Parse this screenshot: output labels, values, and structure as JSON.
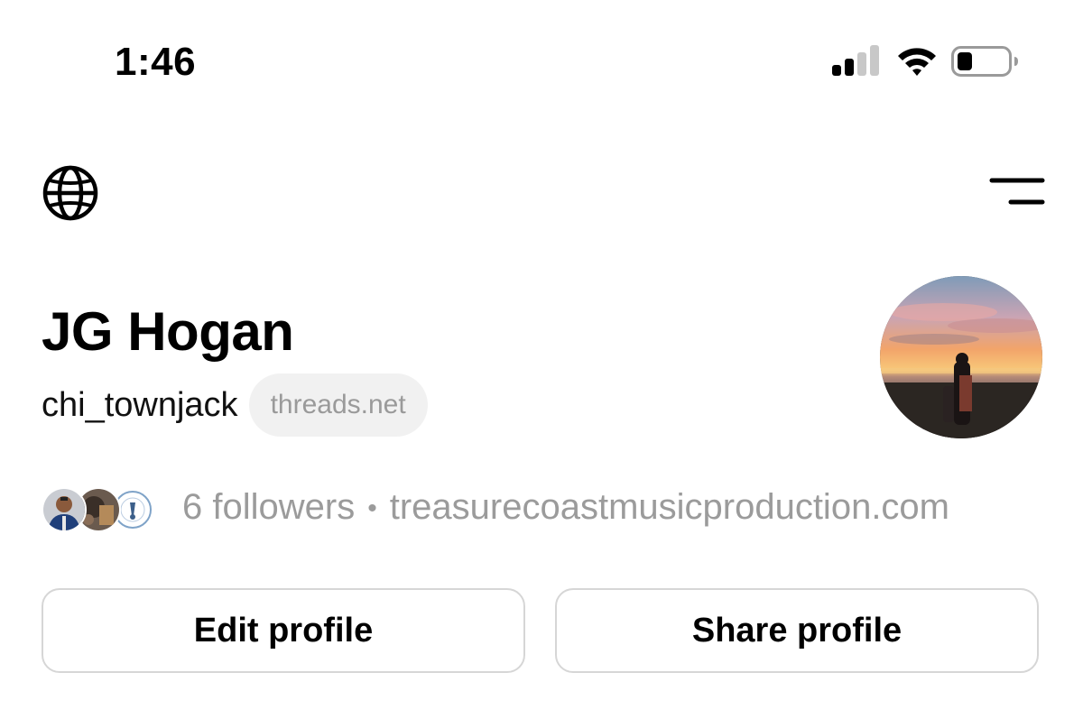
{
  "status_bar": {
    "time": "1:46",
    "icons": [
      "cellular-signal-icon",
      "wifi-icon",
      "battery-icon"
    ],
    "battery_level": 0.3
  },
  "nav": {
    "left_icon": "globe-icon",
    "right_icon": "menu-icon"
  },
  "profile": {
    "name": "JG Hogan",
    "handle": "chi_townjack",
    "domain_badge": "threads.net",
    "avatar": "sunset-beach-photo"
  },
  "followers": {
    "count_text": "6 followers",
    "separator": "•",
    "link": "treasurecoastmusicproduction.com",
    "avatars": [
      "follower-avatar-1",
      "follower-avatar-2",
      "follower-avatar-3"
    ]
  },
  "actions": {
    "edit_label": "Edit profile",
    "share_label": "Share profile"
  },
  "colors": {
    "text_primary": "#000000",
    "text_secondary": "#9b9b9b",
    "pill_bg": "#f1f1f1",
    "button_border": "#d6d6d6"
  }
}
